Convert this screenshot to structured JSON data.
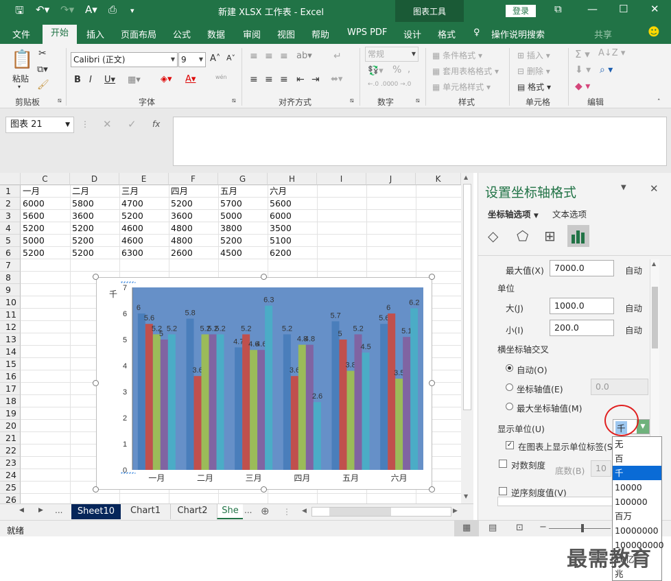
{
  "titlebar": {
    "title": "新建 XLSX 工作表  -  Excel",
    "context_tab": "图表工具",
    "login": "登录"
  },
  "tabs": [
    "文件",
    "开始",
    "插入",
    "页面布局",
    "公式",
    "数据",
    "审阅",
    "视图",
    "帮助",
    "WPS PDF",
    "设计",
    "格式"
  ],
  "tell_me": "操作说明搜索",
  "share": "共享",
  "ribbon": {
    "clipboard": {
      "label": "剪贴板",
      "paste": "粘贴"
    },
    "font": {
      "label": "字体",
      "font_name": "Calibri (正文)",
      "font_size": "9",
      "wen": "wén"
    },
    "align": {
      "label": "对齐方式"
    },
    "number": {
      "label": "数字",
      "format": "常规"
    },
    "styles": {
      "label": "样式",
      "cond": "条件格式",
      "table": "套用表格格式",
      "cell": "单元格样式"
    },
    "cells": {
      "label": "单元格",
      "insert": "插入",
      "delete": "删除",
      "format": "格式"
    },
    "edit": {
      "label": "编辑"
    }
  },
  "formula_bar": {
    "name_box": "图表 21",
    "fx": "fx"
  },
  "grid": {
    "columns": [
      "C",
      "D",
      "E",
      "F",
      "G",
      "H",
      "I",
      "J",
      "K"
    ],
    "rows": [
      "1",
      "2",
      "3",
      "4",
      "5",
      "6",
      "7",
      "8",
      "9",
      "10",
      "11",
      "12",
      "13",
      "14",
      "15",
      "16",
      "17",
      "18",
      "19",
      "20",
      "21",
      "22",
      "23",
      "24",
      "25",
      "26"
    ],
    "data": [
      [
        "一月",
        "二月",
        "三月",
        "四月",
        "五月",
        "六月"
      ],
      [
        "6000",
        "5800",
        "4700",
        "5200",
        "5700",
        "5600"
      ],
      [
        "5600",
        "3600",
        "5200",
        "3600",
        "5000",
        "6000"
      ],
      [
        "5200",
        "5200",
        "4600",
        "4800",
        "3800",
        "3500"
      ],
      [
        "5000",
        "5200",
        "4600",
        "4800",
        "5200",
        "5100"
      ],
      [
        "5200",
        "5200",
        "6300",
        "2600",
        "4500",
        "6200"
      ]
    ]
  },
  "chart_data": {
    "type": "bar",
    "categories": [
      "一月",
      "二月",
      "三月",
      "四月",
      "五月",
      "六月"
    ],
    "series": [
      {
        "values": [
          6.0,
          5.8,
          4.7,
          5.2,
          5.7,
          5.6
        ],
        "color": "#4a7ebb"
      },
      {
        "values": [
          5.6,
          3.6,
          5.2,
          3.6,
          5.0,
          6.0
        ],
        "color": "#c0504d"
      },
      {
        "values": [
          5.2,
          5.2,
          4.6,
          4.8,
          3.8,
          3.5
        ],
        "color": "#9bbb59"
      },
      {
        "values": [
          5.0,
          5.2,
          4.6,
          4.8,
          5.2,
          5.1
        ],
        "color": "#8064a2"
      },
      {
        "values": [
          5.2,
          5.2,
          6.3,
          2.6,
          4.5,
          6.2
        ],
        "color": "#4bacc6"
      }
    ],
    "display_unit_label": "千",
    "y_ticks": [
      "0",
      "1",
      "2",
      "3",
      "4",
      "5",
      "6",
      "7"
    ],
    "ylim": [
      0,
      7
    ],
    "plot_bg": "#6690c8",
    "grid": false
  },
  "sheets": {
    "nav_more": "...",
    "tabs": [
      "Sheet10",
      "Chart1",
      "Chart2",
      "She"
    ],
    "active": "Sheet10"
  },
  "status": {
    "ready": "就绪"
  },
  "pane": {
    "title": "设置坐标轴格式",
    "tab1": "坐标轴选项",
    "tab2": "文本选项",
    "max_label": "最大值(X)",
    "max_value": "7000.0",
    "auto": "自动",
    "unit_label": "单位",
    "major_label": "大(J)",
    "major_value": "1000.0",
    "minor_label": "小(I)",
    "minor_value": "200.0",
    "cross_label": "横坐标轴交叉",
    "radio_auto": "自动(O)",
    "radio_value": "坐标轴值(E)",
    "radio_value_input": "0.0",
    "radio_max": "最大坐标轴值(M)",
    "display_units_label": "显示单位(U)",
    "display_units_value": "千",
    "show_label": "在图表上显示单位标签(S)",
    "log_label": "对数刻度",
    "base_label": "底数(B)",
    "base_value": "10",
    "reverse_label": "逆序刻度值(V)"
  },
  "dropdown": [
    "无",
    "百",
    "千",
    "10000",
    "100000",
    "百万",
    "10000000",
    "100000000",
    "10亿",
    "兆"
  ],
  "dropdown_selected": "千",
  "watermark": "最需教育"
}
